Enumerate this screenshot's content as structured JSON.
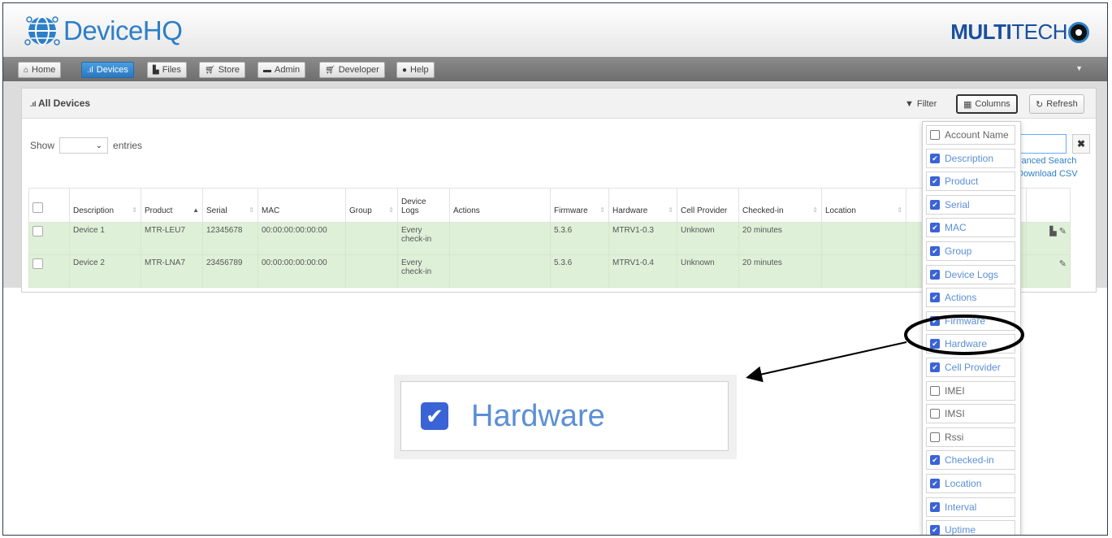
{
  "header": {
    "app_title": "DeviceHQ",
    "brand_bold": "MULTI",
    "brand_light": "TECH"
  },
  "nav": [
    {
      "icon": "home-icon",
      "glyph": "🏠",
      "label": "Home",
      "active": false
    },
    {
      "icon": "bars-icon",
      "glyph": "▮",
      "label": "Devices",
      "active": true
    },
    {
      "icon": "file-icon",
      "glyph": "▆",
      "label": "Files",
      "active": false
    },
    {
      "icon": "cart-icon",
      "glyph": "⛟",
      "label": "Store",
      "active": false
    },
    {
      "icon": "briefcase-icon",
      "glyph": "▬",
      "label": "Admin",
      "active": false
    },
    {
      "icon": "cart-icon",
      "glyph": "⛟",
      "label": "Developer",
      "active": false
    },
    {
      "icon": "help-icon",
      "glyph": "●",
      "label": "Help",
      "active": false
    }
  ],
  "panel": {
    "title": "All Devices",
    "filter_label": "Filter",
    "columns_label": "Columns",
    "refresh_label": "Refresh",
    "show_label": "Show",
    "entries_label": "entries",
    "page_size": "",
    "advanced_search_label": "vanced Search",
    "download_csv_label": "Download CSV"
  },
  "table": {
    "headers": [
      "Description",
      "Product",
      "Serial",
      "MAC",
      "Group",
      "Device Logs",
      "Actions",
      "Firmware",
      "Hardware",
      "Cell Provider",
      "Checked-in",
      "Location"
    ],
    "rows": [
      [
        "Device 1",
        "MTR-LEU7",
        "12345678",
        "00:00:00:00:00:00",
        "",
        "Every check-in",
        "",
        "5.3.6",
        "MTRV1-0.3",
        "Unknown",
        "20 minutes",
        ""
      ],
      [
        "Device 2",
        "MTR-LNA7",
        "23456789",
        "00:00:00:00:00:00",
        "",
        "Every check-in",
        "",
        "5.3.6",
        "MTRV1-0.4",
        "Unknown",
        "20 minutes",
        ""
      ]
    ]
  },
  "columns_menu": [
    {
      "label": "Account Name",
      "checked": false
    },
    {
      "label": "Description",
      "checked": true
    },
    {
      "label": "Product",
      "checked": true
    },
    {
      "label": "Serial",
      "checked": true
    },
    {
      "label": "MAC",
      "checked": true
    },
    {
      "label": "Group",
      "checked": true
    },
    {
      "label": "Device Logs",
      "checked": true
    },
    {
      "label": "Actions",
      "checked": true
    },
    {
      "label": "Firmware",
      "checked": true
    },
    {
      "label": "Hardware",
      "checked": true
    },
    {
      "label": "Cell Provider",
      "checked": true
    },
    {
      "label": "IMEI",
      "checked": false
    },
    {
      "label": "IMSI",
      "checked": false
    },
    {
      "label": "Rssi",
      "checked": false
    },
    {
      "label": "Checked-in",
      "checked": true
    },
    {
      "label": "Location",
      "checked": true
    },
    {
      "label": "Interval",
      "checked": true
    },
    {
      "label": "Uptime",
      "checked": true
    }
  ],
  "zoom_callout": {
    "label": "Hardware",
    "checked": true
  },
  "colors": {
    "accent": "#2d7fc7",
    "checkbox": "#3a63d6",
    "row_success": "#dff0d8",
    "annotation": "#000000"
  }
}
